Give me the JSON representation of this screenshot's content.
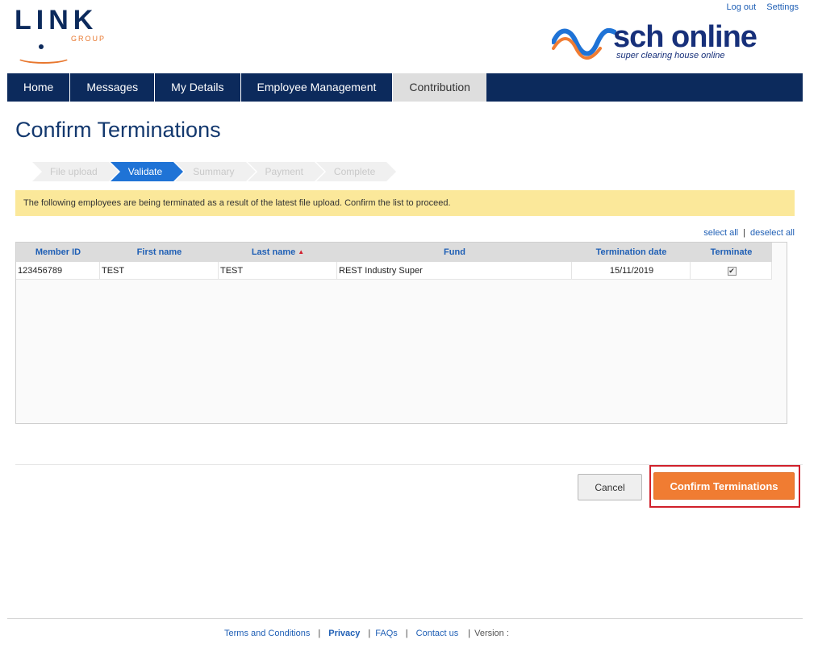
{
  "header": {
    "top_links": [
      "Log out",
      "Settings"
    ],
    "link_logo_text": "LINK",
    "link_logo_sub": "GROUP",
    "brand_name": "sch online",
    "brand_tagline": "super clearing house online"
  },
  "nav": {
    "items": [
      "Home",
      "Messages",
      "My Details",
      "Employee Management",
      "Contribution"
    ],
    "active": "Contribution"
  },
  "page": {
    "title": "Confirm Terminations"
  },
  "steps": [
    "File upload",
    "Validate",
    "Summary",
    "Payment",
    "Complete"
  ],
  "alert": {
    "message": "The following employees are being terminated as a result of the latest file upload. Confirm the list to proceed."
  },
  "selection": {
    "select_all": "select all",
    "deselect_all": "deselect all"
  },
  "table": {
    "columns": [
      "Member ID",
      "First name",
      "Last name",
      "Fund",
      "Termination date",
      "Terminate"
    ],
    "rows": [
      {
        "member_id": "123456789",
        "first_name": "TEST",
        "last_name": "TEST",
        "fund": "REST Industry Super",
        "termination_date": "15/11/2019",
        "terminate": true
      }
    ]
  },
  "actions": {
    "cancel": "Cancel",
    "confirm": "Confirm Terminations"
  },
  "footer": {
    "links": [
      "Terms and Conditions",
      "Privacy",
      "FAQs",
      "Contact us"
    ],
    "version": "Version :"
  },
  "colors": {
    "nav_bg": "#0c2a5c",
    "accent_orange": "#f07c32",
    "step_active": "#1f73d6",
    "alert_bg": "#fbe89a",
    "highlight_red": "#d0202b"
  }
}
